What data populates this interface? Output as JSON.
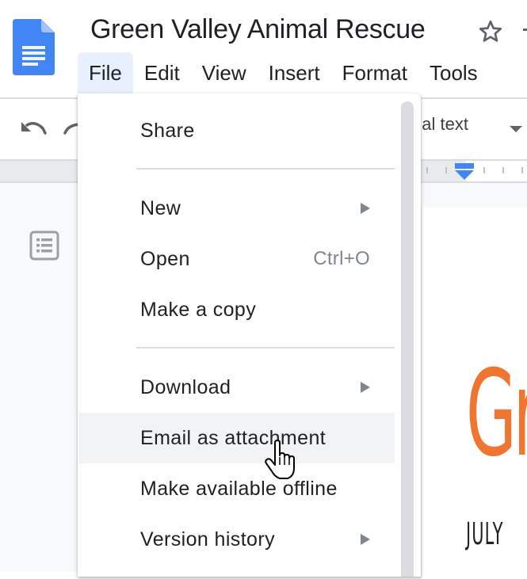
{
  "app": {
    "document_title": "Green Valley Animal Rescue",
    "icons": {
      "logo": "google-docs-icon",
      "star": "star-outline-icon",
      "undo": "undo-icon",
      "redo": "redo-icon",
      "outline": "document-outline-icon",
      "cursor": "hand-pointer-cursor"
    },
    "colors": {
      "docs_blue": "#4285f4",
      "active_menu_bg": "#e8f0fe",
      "hover_item_bg": "#f1f3f4",
      "heading_orange": "#f07530"
    }
  },
  "menubar": {
    "items": [
      {
        "label": "File",
        "active": true
      },
      {
        "label": "Edit",
        "active": false
      },
      {
        "label": "View",
        "active": false
      },
      {
        "label": "Insert",
        "active": false
      },
      {
        "label": "Format",
        "active": false
      },
      {
        "label": "Tools",
        "active": false
      }
    ]
  },
  "toolbar": {
    "paragraph_style_visible": "nal text"
  },
  "file_menu": {
    "items": [
      {
        "label": "Share",
        "shortcut": "",
        "submenu": false
      },
      {
        "label": "New",
        "shortcut": "",
        "submenu": true
      },
      {
        "label": "Open",
        "shortcut": "Ctrl+O",
        "submenu": false
      },
      {
        "label": "Make a copy",
        "shortcut": "",
        "submenu": false
      },
      {
        "label": "Download",
        "shortcut": "",
        "submenu": true
      },
      {
        "label": "Email as attachment",
        "shortcut": "",
        "submenu": false,
        "hovered": true
      },
      {
        "label": "Make available offline",
        "shortcut": "",
        "submenu": false
      },
      {
        "label": "Version history",
        "shortcut": "",
        "submenu": true
      }
    ]
  },
  "document": {
    "heading_visible": "Gr",
    "subheading_visible": "JULY"
  }
}
